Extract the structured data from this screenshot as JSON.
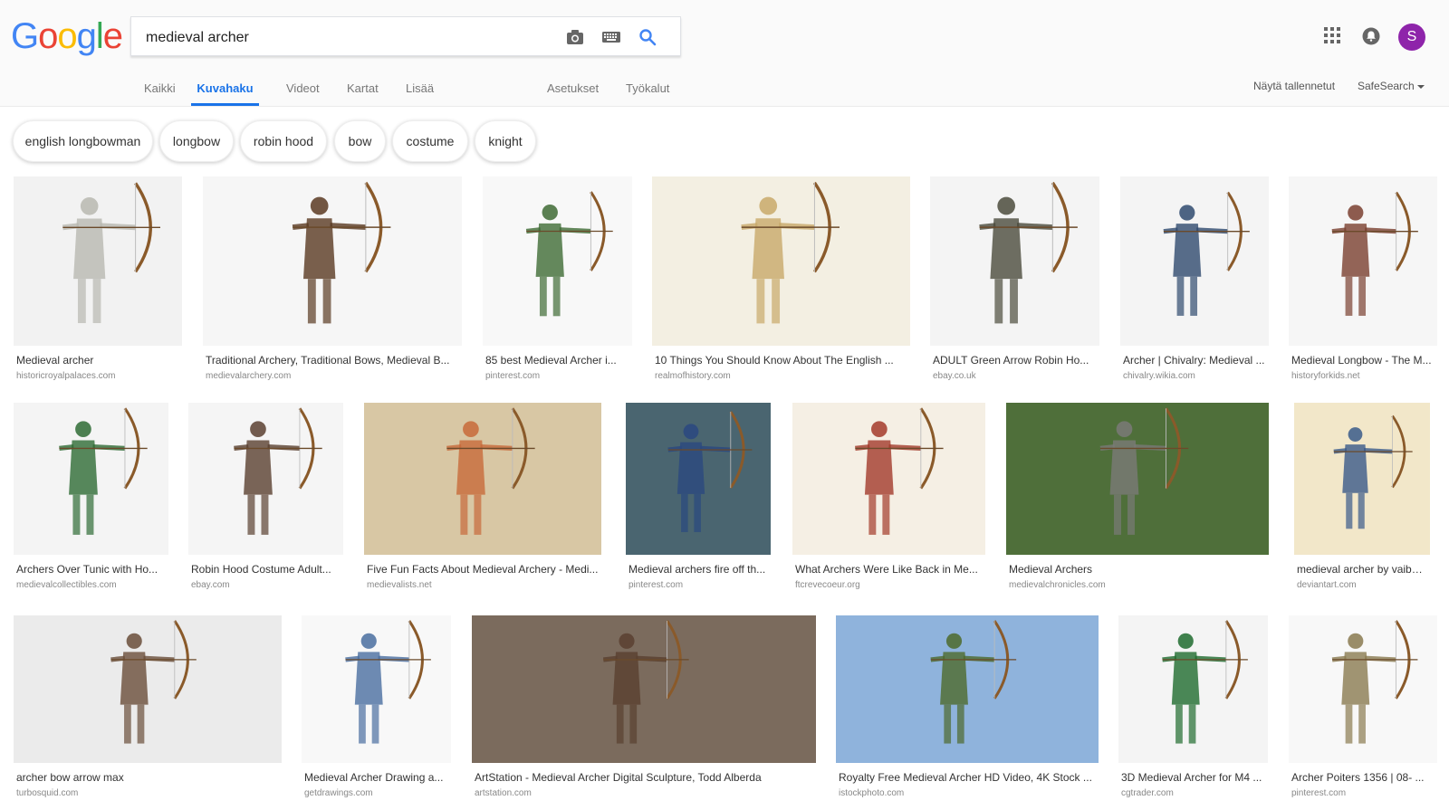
{
  "logo_text": [
    "G",
    "o",
    "o",
    "g",
    "l",
    "e"
  ],
  "logo_colors": [
    "#4285F4",
    "#EA4335",
    "#FBBC05",
    "#4285F4",
    "#34A853",
    "#EA4335"
  ],
  "search": {
    "query": "medieval archer"
  },
  "header_icons": [
    "camera-icon",
    "keyboard-icon",
    "search-icon",
    "apps-grid-icon",
    "notifications-icon"
  ],
  "account": {
    "initial": "S",
    "color": "#8e24aa"
  },
  "tabs": [
    "Kaikki",
    "Kuvahaku",
    "Videot",
    "Kartat",
    "Lisää"
  ],
  "active_tab": "Kuvahaku",
  "settings_tabs": [
    "Asetukset",
    "Työkalut"
  ],
  "right_links": {
    "saved": "Näytä tallennetut",
    "safesearch": "SafeSearch"
  },
  "chips": [
    "english longbowman",
    "longbow",
    "robin hood",
    "bow",
    "costume",
    "knight"
  ],
  "results": [
    {
      "title": "Medieval archer",
      "source": "historicroyalpalaces.com",
      "bg": "#f2f2f2",
      "fg": "#b8b8b0"
    },
    {
      "title": "Traditional Archery, Traditional Bows, Medieval B...",
      "source": "medievalarchery.com",
      "bg": "#f6f6f6",
      "fg": "#5a3a22"
    },
    {
      "title": "85 best Medieval Archer i...",
      "source": "pinterest.com",
      "bg": "#f8f8f8",
      "fg": "#3f6b35"
    },
    {
      "title": "10 Things You Should Know About The English ...",
      "source": "realmofhistory.com",
      "bg": "#f3efe2",
      "fg": "#c8a96a"
    },
    {
      "title": "ADULT Green Arrow Robin Ho...",
      "source": "ebay.co.uk",
      "bg": "#f4f4f4",
      "fg": "#4b4b3c"
    },
    {
      "title": "Archer | Chivalry: Medieval ...",
      "source": "chivalry.wikia.com",
      "bg": "#f4f4f4",
      "fg": "#2f4a6e"
    },
    {
      "title": "Medieval Longbow - The M...",
      "source": "historyforkids.net",
      "bg": "#f6f6f6",
      "fg": "#7a4030"
    },
    {
      "title": "Archers Over Tunic with Ho...",
      "source": "medievalcollectibles.com",
      "bg": "#f4f4f4",
      "fg": "#2e6b34"
    },
    {
      "title": "Robin Hood Costume Adult...",
      "source": "ebay.com",
      "bg": "#f5f5f5",
      "fg": "#5a4030"
    },
    {
      "title": "Five Fun Facts About Medieval Archery - Medi...",
      "source": "medievalists.net",
      "bg": "#d8c7a4",
      "fg": "#c86a3a"
    },
    {
      "title": "Medieval archers fire off th...",
      "source": "pinterest.com",
      "bg": "#4a6570",
      "fg": "#2a4880"
    },
    {
      "title": "What Archers Were Like Back in Me...",
      "source": "ftcrevecoeur.org",
      "bg": "#f5efe4",
      "fg": "#a33a2a"
    },
    {
      "title": "Medieval Archers",
      "source": "medievalchronicles.com",
      "bg": "#4f6f3a",
      "fg": "#7a7a78"
    },
    {
      "title": "medieval archer by vaibha...",
      "source": "deviantart.com",
      "bg": "#f2e7c9",
      "fg": "#3a5a8a"
    },
    {
      "title": "archer bow arrow max",
      "source": "turbosquid.com",
      "bg": "#ebebeb",
      "fg": "#6a4e3a"
    },
    {
      "title": "Medieval Archer Drawing a...",
      "source": "getdrawings.com",
      "bg": "#f8f8f8",
      "fg": "#4a6ea0"
    },
    {
      "title": "ArtStation - Medieval Archer Digital Sculpture, Todd Alberda",
      "source": "artstation.com",
      "bg": "#7b6b5d",
      "fg": "#5a4030"
    },
    {
      "title": "Royalty Free Medieval Archer HD Video, 4K Stock ...",
      "source": "istockphoto.com",
      "bg": "#8fb3dc",
      "fg": "#4d6a2c"
    },
    {
      "title": "3D Medieval Archer for M4 ...",
      "source": "cgtrader.com",
      "bg": "#f4f4f4",
      "fg": "#1f6b2e"
    },
    {
      "title": "Archer Poiters 1356 | 08- ...",
      "source": "pinterest.com",
      "bg": "#f8f8f8",
      "fg": "#8a7a50"
    }
  ]
}
